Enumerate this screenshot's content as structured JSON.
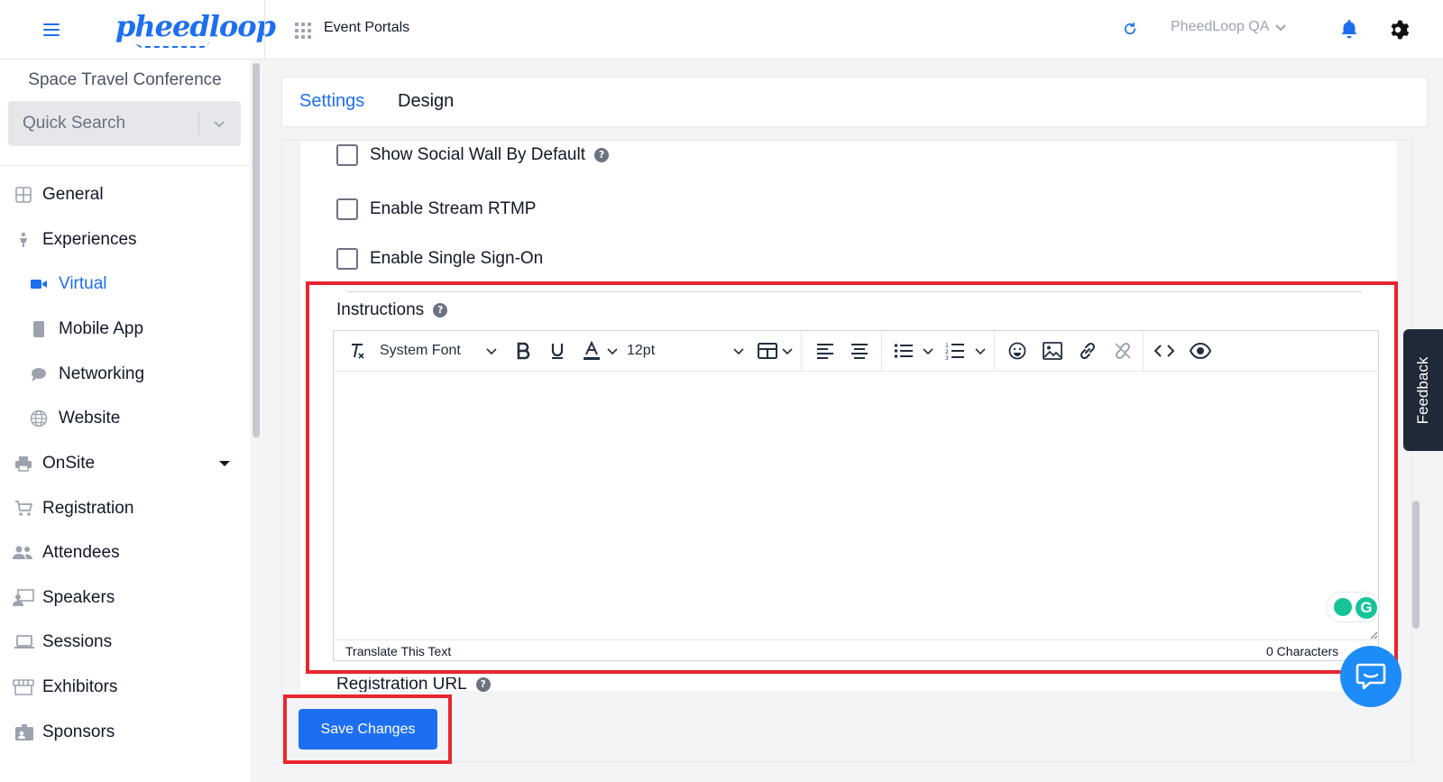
{
  "header": {
    "logo_text": "pheedloop",
    "portal_label": "Event Portals",
    "org_name": "PheedLoop QA"
  },
  "sidebar": {
    "event_name": "Space Travel Conference",
    "quick_search_placeholder": "Quick Search",
    "items": [
      {
        "label": "General",
        "icon": "grid-icon"
      },
      {
        "label": "Experiences",
        "icon": "person-icon"
      },
      {
        "label": "Virtual",
        "icon": "video-camera-icon",
        "active": true
      },
      {
        "label": "Mobile App",
        "icon": "phone-icon"
      },
      {
        "label": "Networking",
        "icon": "chat-icon"
      },
      {
        "label": "Website",
        "icon": "globe-icon"
      },
      {
        "label": "OnSite",
        "icon": "printer-icon"
      },
      {
        "label": "Registration",
        "icon": "cart-icon"
      },
      {
        "label": "Attendees",
        "icon": "people-icon"
      },
      {
        "label": "Speakers",
        "icon": "speaker-icon"
      },
      {
        "label": "Sessions",
        "icon": "laptop-icon"
      },
      {
        "label": "Exhibitors",
        "icon": "booth-icon"
      },
      {
        "label": "Sponsors",
        "icon": "badge-icon"
      }
    ]
  },
  "tabs": [
    {
      "label": "Settings",
      "active": true
    },
    {
      "label": "Design",
      "active": false
    }
  ],
  "settings": {
    "checkboxes": [
      {
        "label": "Show Social Wall By Default",
        "checked": false,
        "help": true
      },
      {
        "label": "Enable Stream RTMP",
        "checked": false,
        "help": false
      },
      {
        "label": "Enable Single Sign-On",
        "checked": false,
        "help": false
      }
    ],
    "instructions_label": "Instructions",
    "registration_url_label": "Registration URL"
  },
  "editor": {
    "font_family": "System Font",
    "font_size": "12pt",
    "status_left": "Translate This Text",
    "status_right": "0 Characters"
  },
  "actions": {
    "save_label": "Save Changes"
  },
  "feedback_label": "Feedback",
  "colors": {
    "accent": "#1d6ff2",
    "highlight": "#e8262f",
    "feedback_bg": "#1f2937"
  }
}
